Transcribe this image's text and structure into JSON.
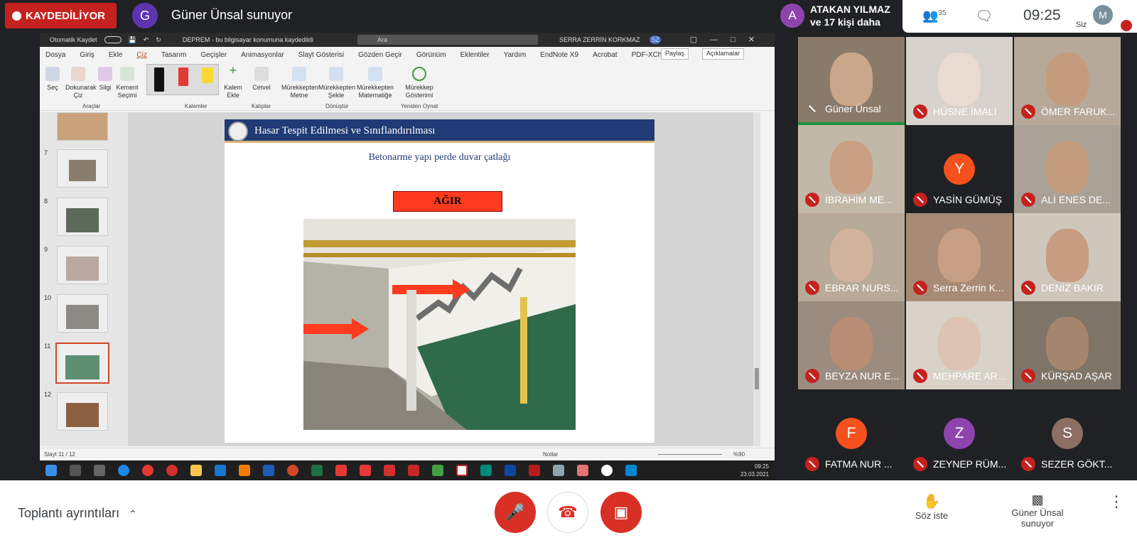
{
  "recording": {
    "label": "KAYDEDİLİYOR"
  },
  "presenter": {
    "initial": "G",
    "title": "Güner Ünsal sunuyor"
  },
  "top_right": {
    "initial": "A",
    "name_line1": "ATAKAN YILMAZ",
    "name_line2": "ve 17 kişi daha",
    "people_count": "35",
    "time": "09:25",
    "me_initial": "M",
    "me_label": "Siz"
  },
  "ppt": {
    "autosave": "Otomatik Kaydet",
    "doc_title": "DEPREM - bu bilgisayar konumuna kaydedildi",
    "search_placeholder": "Ara",
    "user": "SERRA ZERRİN KORKMAZ",
    "user_initials": "SZ",
    "menu": [
      "Dosya",
      "Giriş",
      "Ekle",
      "Çiz",
      "Tasarım",
      "Geçişler",
      "Animasyonlar",
      "Slayt Gösterisi",
      "Gözden Geçir",
      "Görünüm",
      "Eklentiler",
      "Yardım",
      "EndNote X9",
      "Acrobat",
      "PDF-XChange"
    ],
    "share": "Paylaş",
    "comments": "Açıklamalar",
    "tools": [
      {
        "l1": "Seç",
        "l2": ""
      },
      {
        "l1": "Dokunarak",
        "l2": "Çiz"
      },
      {
        "l1": "Silgi",
        "l2": ""
      },
      {
        "l1": "Kement",
        "l2": "Seçimi"
      }
    ],
    "tools2": [
      {
        "l1": "Kalem",
        "l2": "Ekle"
      },
      {
        "l1": "Cetvel",
        "l2": ""
      },
      {
        "l1": "Mürekkepten",
        "l2": "Metne"
      },
      {
        "l1": "Mürekkepten",
        "l2": "Şekle"
      },
      {
        "l1": "Mürekkepten",
        "l2": "Matematiğe"
      },
      {
        "l1": "Mürekkep",
        "l2": "Gösterimi"
      }
    ],
    "groups": [
      "Araçlar",
      "Kalemler",
      "Kalıplar",
      "Dönüştür",
      "Yeniden Oynat"
    ],
    "thumb_numbers": [
      "7",
      "8",
      "9",
      "10",
      "11",
      "12"
    ],
    "slide": {
      "title": "Hasar Tespit Edilmesi ve Sınıflandırılması",
      "subtitle": "Betonarme yapı perde duvar çatlağı",
      "badge": "AĞIR"
    },
    "status_left": "Slayt 11 / 12",
    "status_notes": "Notlar",
    "zoom": "%90",
    "task_time": "09:25",
    "task_date": "23.03.2021"
  },
  "participants": [
    {
      "name": "Güner Ünsal",
      "speaking": true
    },
    {
      "name": "HÜSNE İMALI"
    },
    {
      "name": "ÖMER FARUK..."
    },
    {
      "name": "İBRAHİM ME..."
    },
    {
      "name": "YASİN GÜMÜŞ",
      "initial": "Y",
      "color": "#f4511e"
    },
    {
      "name": "ALİ ENES DE..."
    },
    {
      "name": "EBRAR NURS..."
    },
    {
      "name": "Serra Zerrin K..."
    },
    {
      "name": "DENİZ BAKIR"
    },
    {
      "name": "BEYZA NUR E..."
    },
    {
      "name": "MEHPARE AR..."
    },
    {
      "name": "KÜRŞAD AŞAR"
    },
    {
      "name": "FATMA NUR ...",
      "initial": "F",
      "color": "#f4511e"
    },
    {
      "name": "ZEYNEP RÜM...",
      "initial": "Z",
      "color": "#8e44ad"
    },
    {
      "name": "SEZER GÖKT...",
      "initial": "S",
      "color": "#8d6e63"
    }
  ],
  "bottom": {
    "details": "Toplantı ayrıntıları",
    "raise": "Söz iste",
    "present_line1": "Güner Ünsal",
    "present_line2": "sunuyor"
  }
}
